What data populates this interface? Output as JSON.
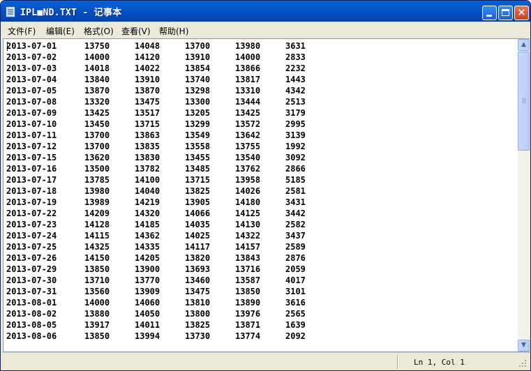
{
  "window": {
    "title": "IPL■ND.TXT - 记事本"
  },
  "title_buttons": {
    "minimize": "minimize-icon",
    "maximize": "maximize-icon",
    "close": "close-icon",
    "close_glyph": "✕"
  },
  "menu": [
    "文件(F)",
    "编辑(E)",
    "格式(O)",
    "查看(V)",
    "帮助(H)"
  ],
  "content": {
    "rows": [
      [
        "2013-07-01",
        "13750",
        "14048",
        "13700",
        "13980",
        "3631"
      ],
      [
        "2013-07-02",
        "14000",
        "14120",
        "13910",
        "14000",
        "2833"
      ],
      [
        "2013-07-03",
        "14018",
        "14022",
        "13854",
        "13866",
        "2232"
      ],
      [
        "2013-07-04",
        "13840",
        "13910",
        "13740",
        "13817",
        "1443"
      ],
      [
        "2013-07-05",
        "13870",
        "13870",
        "13298",
        "13310",
        "4342"
      ],
      [
        "2013-07-08",
        "13320",
        "13475",
        "13300",
        "13444",
        "2513"
      ],
      [
        "2013-07-09",
        "13425",
        "13517",
        "13205",
        "13425",
        "3179"
      ],
      [
        "2013-07-10",
        "13450",
        "13715",
        "13299",
        "13572",
        "2995"
      ],
      [
        "2013-07-11",
        "13700",
        "13863",
        "13549",
        "13642",
        "3139"
      ],
      [
        "2013-07-12",
        "13700",
        "13835",
        "13558",
        "13755",
        "1992"
      ],
      [
        "2013-07-15",
        "13620",
        "13830",
        "13455",
        "13540",
        "3092"
      ],
      [
        "2013-07-16",
        "13500",
        "13782",
        "13485",
        "13762",
        "2866"
      ],
      [
        "2013-07-17",
        "13785",
        "14100",
        "13715",
        "13958",
        "5185"
      ],
      [
        "2013-07-18",
        "13980",
        "14040",
        "13825",
        "14026",
        "2581"
      ],
      [
        "2013-07-19",
        "13989",
        "14219",
        "13905",
        "14180",
        "3431"
      ],
      [
        "2013-07-22",
        "14209",
        "14320",
        "14066",
        "14125",
        "3442"
      ],
      [
        "2013-07-23",
        "14128",
        "14185",
        "14035",
        "14130",
        "2582"
      ],
      [
        "2013-07-24",
        "14115",
        "14362",
        "14025",
        "14322",
        "3437"
      ],
      [
        "2013-07-25",
        "14325",
        "14335",
        "14117",
        "14157",
        "2589"
      ],
      [
        "2013-07-26",
        "14150",
        "14205",
        "13820",
        "13843",
        "2876"
      ],
      [
        "2013-07-29",
        "13850",
        "13900",
        "13693",
        "13716",
        "2059"
      ],
      [
        "2013-07-30",
        "13710",
        "13770",
        "13460",
        "13587",
        "4017"
      ],
      [
        "2013-07-31",
        "13560",
        "13909",
        "13475",
        "13850",
        "3101"
      ],
      [
        "2013-08-01",
        "14000",
        "14060",
        "13810",
        "13890",
        "3616"
      ],
      [
        "2013-08-02",
        "13880",
        "14050",
        "13800",
        "13976",
        "2565"
      ],
      [
        "2013-08-05",
        "13917",
        "14011",
        "13825",
        "13871",
        "1639"
      ],
      [
        "2013-08-06",
        "13850",
        "13994",
        "13730",
        "13774",
        "2092"
      ]
    ]
  },
  "scrollbar": {
    "up_glyph": "▲",
    "down_glyph": "▼"
  },
  "status": {
    "position": "Ln 1, Col 1"
  },
  "colors": {
    "titlebar": "#0552c8",
    "close_button": "#c8401e",
    "window_frame": "#ece9d8"
  }
}
